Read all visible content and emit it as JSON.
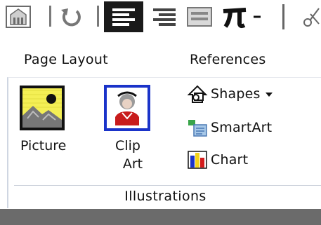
{
  "quick_access": {
    "items": [
      {
        "icon": "building-icon"
      },
      {
        "icon": "undo-icon"
      },
      {
        "icon": "align-left-icon",
        "state": "selected"
      },
      {
        "icon": "align-right-icon"
      },
      {
        "icon": "picture-frame-icon"
      },
      {
        "icon": "pi-icon"
      },
      {
        "icon": "dropdown-arrow-icon"
      },
      {
        "icon": "scissors-icon"
      }
    ]
  },
  "ribbon": {
    "tabs": [
      {
        "label": "Page Layout"
      },
      {
        "label": "References"
      }
    ],
    "group": {
      "title": "Illustrations",
      "picture_label": "Picture",
      "clipart_label_line1": "Clip",
      "clipart_label_line2": "Art",
      "shapes_label": "Shapes",
      "smartart_label": "SmartArt",
      "chart_label": "Chart"
    }
  },
  "colors": {
    "selected_highlight": "#1a1a1a",
    "picture_bg": "#f4ef55",
    "clipart_border": "#1a33c9",
    "group_border": "#cfd6e2",
    "bottom_bar": "#6b6b6b"
  }
}
